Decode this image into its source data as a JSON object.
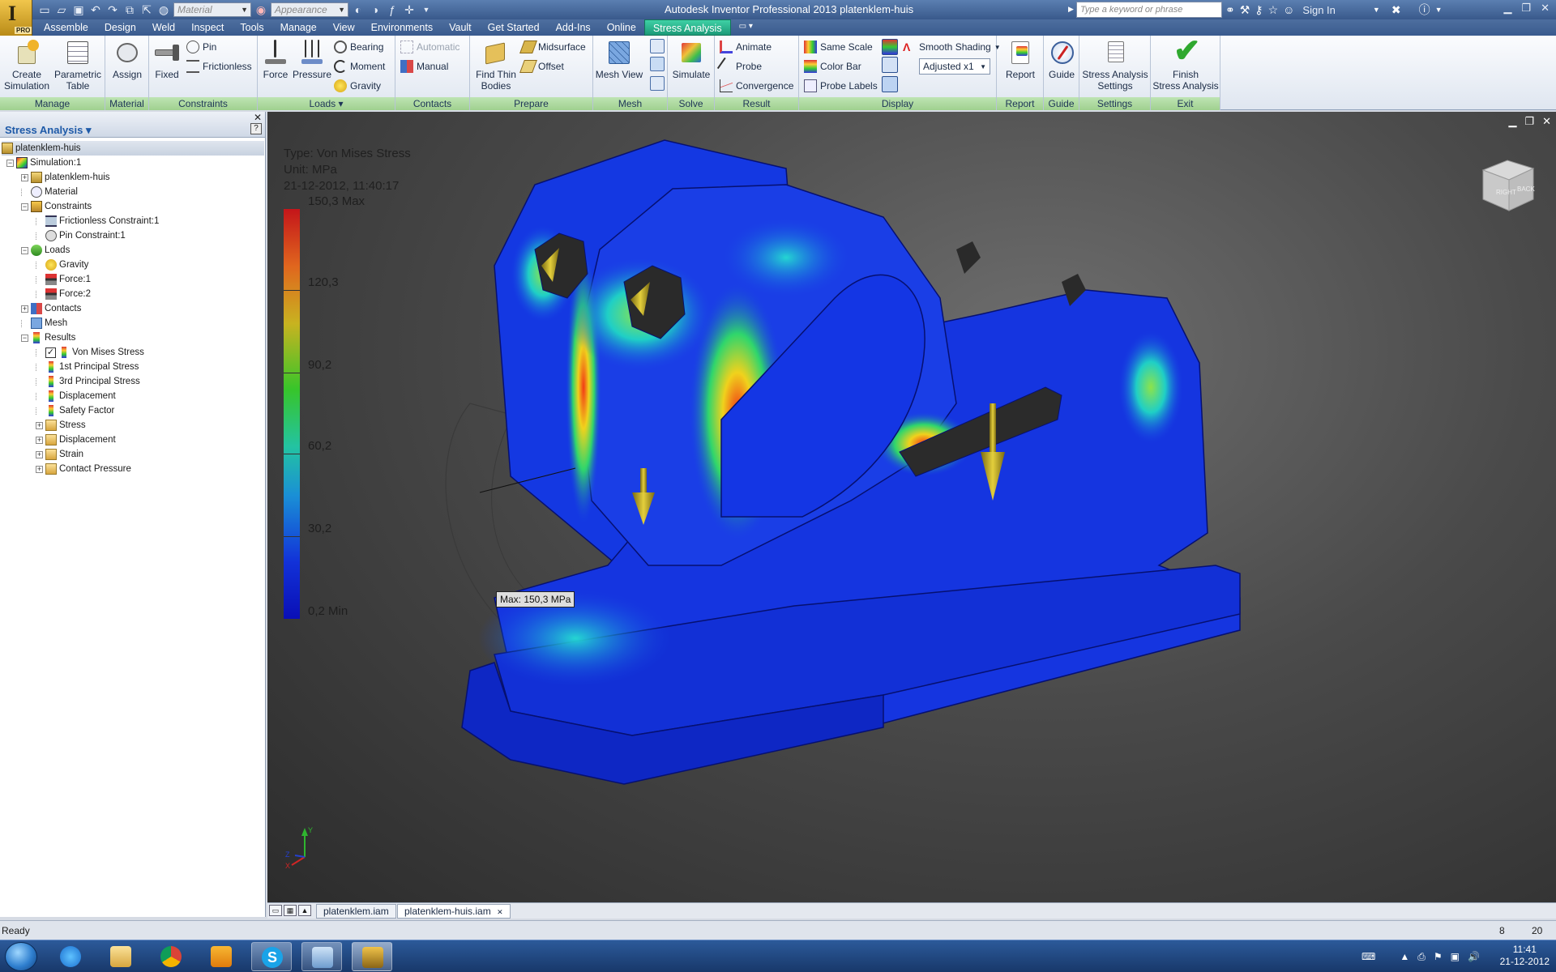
{
  "title_bar": {
    "quick_access": {
      "material_placeholder": "Material",
      "appearance_placeholder": "Appearance"
    },
    "window_title": "Autodesk Inventor Professional 2013    platenklem-huis",
    "search_placeholder": "Type a keyword or phrase",
    "signin": "Sign In",
    "app_logo_badge": "PRO"
  },
  "menu_tabs": [
    {
      "label": "Assemble"
    },
    {
      "label": "Design"
    },
    {
      "label": "Weld"
    },
    {
      "label": "Inspect"
    },
    {
      "label": "Tools"
    },
    {
      "label": "Manage"
    },
    {
      "label": "View"
    },
    {
      "label": "Environments"
    },
    {
      "label": "Vault"
    },
    {
      "label": "Get Started"
    },
    {
      "label": "Add-Ins"
    },
    {
      "label": "Online"
    },
    {
      "label": "Stress Analysis"
    }
  ],
  "ribbon": {
    "manage": {
      "label": "Manage",
      "create_simulation": "Create\nSimulation",
      "parametric_table": "Parametric\nTable"
    },
    "material": {
      "label": "Material",
      "assign": "Assign"
    },
    "constraints": {
      "label": "Constraints",
      "fixed": "Fixed",
      "pin": "Pin",
      "frictionless": "Frictionless"
    },
    "loads": {
      "label": "Loads ▾",
      "force": "Force",
      "pressure": "Pressure",
      "bearing": "Bearing",
      "moment": "Moment",
      "gravity": "Gravity"
    },
    "contacts": {
      "label": "Contacts",
      "automatic": "Automatic",
      "manual": "Manual"
    },
    "prepare": {
      "label": "Prepare",
      "find_thin_bodies": "Find Thin\nBodies",
      "midsurface": "Midsurface",
      "offset": "Offset"
    },
    "mesh": {
      "label": "Mesh",
      "mesh_view": "Mesh View"
    },
    "solve": {
      "label": "Solve",
      "simulate": "Simulate"
    },
    "result": {
      "label": "Result",
      "animate": "Animate",
      "probe": "Probe",
      "convergence": "Convergence"
    },
    "display": {
      "label": "Display",
      "same_scale": "Same Scale",
      "color_bar": "Color Bar",
      "probe_labels": "Probe Labels",
      "shading": "Smooth Shading",
      "adjusted": "Adjusted x1"
    },
    "report": {
      "label": "Report",
      "report": "Report"
    },
    "guide": {
      "label": "Guide",
      "guide": "Guide"
    },
    "settings": {
      "label": "Settings",
      "stress_settings": "Stress Analysis\nSettings"
    },
    "exit": {
      "label": "Exit",
      "finish": "Finish\nStress Analysis"
    }
  },
  "browser": {
    "title": "Stress Analysis ▾",
    "help": "?",
    "close": "✕",
    "tree": [
      {
        "label": "platenklem-huis",
        "level": 0,
        "expander": "",
        "icon": "assembly-icon"
      },
      {
        "label": "Simulation:1",
        "level": 1,
        "expander": "−",
        "icon": "simulation-icon"
      },
      {
        "label": "platenklem-huis",
        "level": 2,
        "expander": "+",
        "icon": "assembly-icon"
      },
      {
        "label": "Material",
        "level": 2,
        "expander": "",
        "icon": "material-icon"
      },
      {
        "label": "Constraints",
        "level": 2,
        "expander": "−",
        "icon": "constraints-icon"
      },
      {
        "label": "Frictionless Constraint:1",
        "level": 3,
        "expander": "",
        "icon": "frictionless-icon"
      },
      {
        "label": "Pin Constraint:1",
        "level": 3,
        "expander": "",
        "icon": "pin-icon"
      },
      {
        "label": "Loads",
        "level": 2,
        "expander": "−",
        "icon": "loads-icon"
      },
      {
        "label": "Gravity",
        "level": 3,
        "expander": "",
        "icon": "gravity-icon"
      },
      {
        "label": "Force:1",
        "level": 3,
        "expander": "",
        "icon": "force-icon"
      },
      {
        "label": "Force:2",
        "level": 3,
        "expander": "",
        "icon": "force-icon"
      },
      {
        "label": "Contacts",
        "level": 2,
        "expander": "+",
        "icon": "contacts-icon"
      },
      {
        "label": "Mesh",
        "level": 2,
        "expander": "",
        "icon": "mesh-icon"
      },
      {
        "label": "Results",
        "level": 2,
        "expander": "−",
        "icon": "results-icon"
      },
      {
        "label": "Von Mises Stress",
        "level": 3,
        "expander": "",
        "icon": "result-bar-icon",
        "checked": true
      },
      {
        "label": "1st Principal Stress",
        "level": 3,
        "expander": "",
        "icon": "result-bar-icon"
      },
      {
        "label": "3rd Principal Stress",
        "level": 3,
        "expander": "",
        "icon": "result-bar-icon"
      },
      {
        "label": "Displacement",
        "level": 3,
        "expander": "",
        "icon": "result-bar-icon"
      },
      {
        "label": "Safety Factor",
        "level": 3,
        "expander": "",
        "icon": "result-bar-icon"
      },
      {
        "label": "Stress",
        "level": 3,
        "expander": "+",
        "icon": "folder-icon"
      },
      {
        "label": "Displacement",
        "level": 3,
        "expander": "+",
        "icon": "folder-icon"
      },
      {
        "label": "Strain",
        "level": 3,
        "expander": "+",
        "icon": "folder-icon"
      },
      {
        "label": "Contact Pressure",
        "level": 3,
        "expander": "+",
        "icon": "folder-icon"
      }
    ]
  },
  "viewport": {
    "type": "Type: Von Mises Stress",
    "unit": "Unit: MPa",
    "date": "21-12-2012, 11:40:17",
    "scale_labels": [
      "150,3 Max",
      "120,3",
      "90,2",
      "60,2",
      "30,2",
      "0,2 Min"
    ],
    "max_probe": "Max: 150,3 MPa",
    "viewcube": {
      "left": "RIGHT",
      "right": "BACK"
    },
    "axis": {
      "x": "X",
      "y": "Y",
      "z": "Z"
    }
  },
  "doc_tabs": [
    {
      "label": "platenklem.iam",
      "active": false
    },
    {
      "label": "platenklem-huis.iam",
      "active": true,
      "close": "✕"
    }
  ],
  "status_bar": {
    "text": "Ready",
    "n1": "8",
    "n2": "20"
  },
  "taskbar": {
    "apps": [
      "ie-icon",
      "explorer-icon",
      "chrome-icon",
      "outlook-icon",
      "skype-icon",
      "control-panel-icon",
      "inventor-icon"
    ],
    "clock_time": "11:41",
    "clock_date": "21-12-2012"
  }
}
